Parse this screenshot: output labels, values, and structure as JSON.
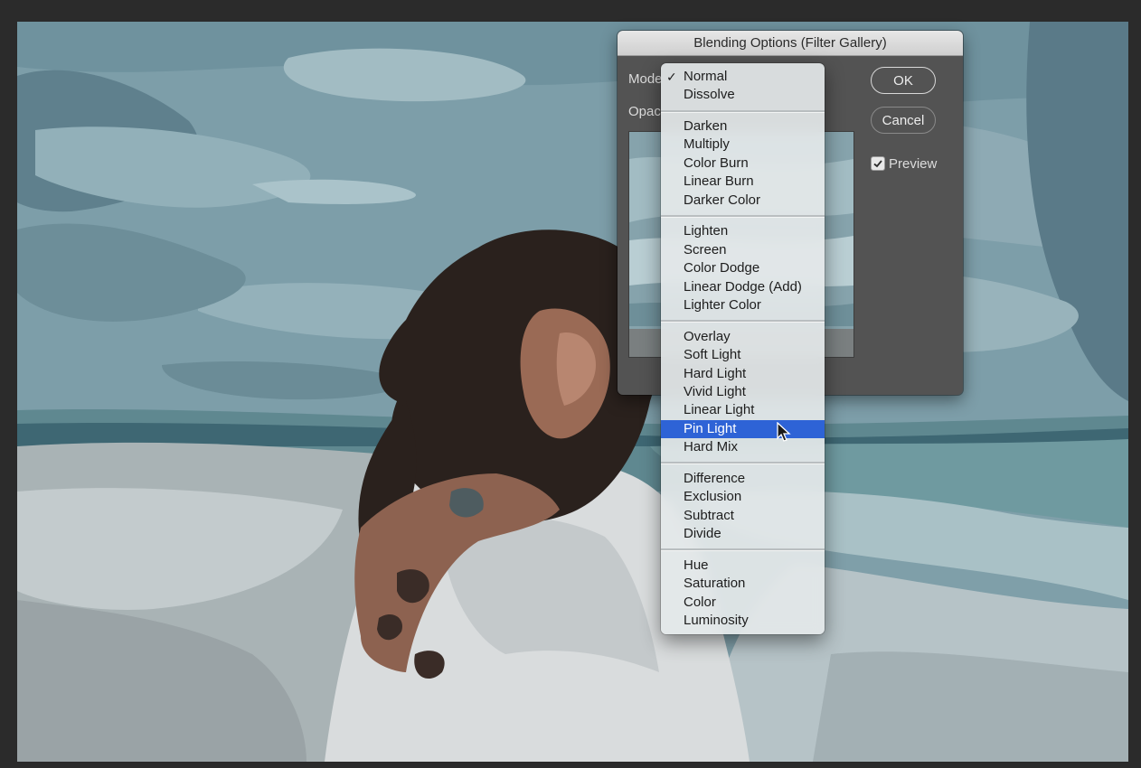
{
  "dialog": {
    "title": "Blending Options (Filter Gallery)",
    "mode_label": "Mode",
    "opacity_label": "Opac",
    "ok_label": "OK",
    "cancel_label": "Cancel",
    "preview_label": "Preview",
    "preview_checked": true
  },
  "mode_menu": {
    "current": "Normal",
    "highlighted": "Pin Light",
    "groups": [
      [
        "Normal",
        "Dissolve"
      ],
      [
        "Darken",
        "Multiply",
        "Color Burn",
        "Linear Burn",
        "Darker Color"
      ],
      [
        "Lighten",
        "Screen",
        "Color Dodge",
        "Linear Dodge (Add)",
        "Lighter Color"
      ],
      [
        "Overlay",
        "Soft Light",
        "Hard Light",
        "Vivid Light",
        "Linear Light",
        "Pin Light",
        "Hard Mix"
      ],
      [
        "Difference",
        "Exclusion",
        "Subtract",
        "Divide"
      ],
      [
        "Hue",
        "Saturation",
        "Color",
        "Luminosity"
      ]
    ]
  },
  "colors": {
    "highlight": "#2e63d6",
    "dialog_bg": "#535353",
    "app_bg": "#2b2b2b"
  }
}
